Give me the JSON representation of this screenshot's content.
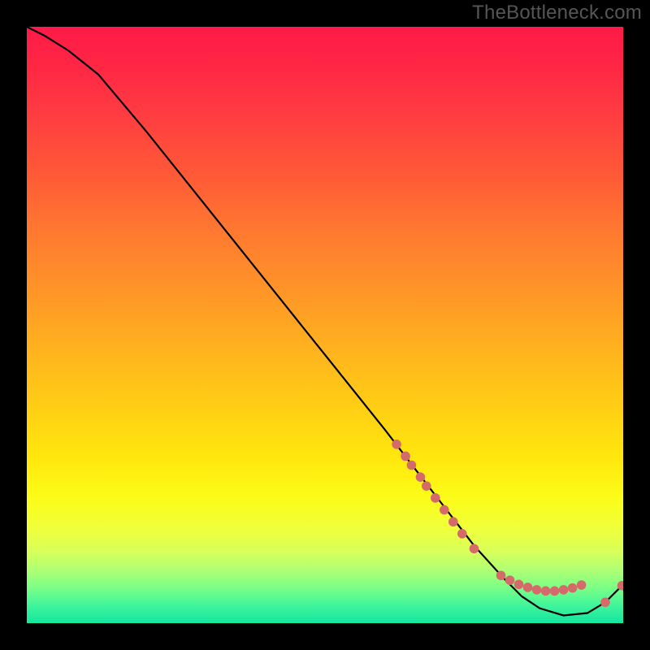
{
  "watermark": "TheBottleneck.com",
  "chart_data": {
    "type": "line",
    "title": "",
    "xlabel": "",
    "ylabel": "",
    "xlim": [
      0,
      100
    ],
    "ylim": [
      0,
      100
    ],
    "grid": false,
    "legend": false,
    "series": [
      {
        "name": "curve",
        "x": [
          0,
          3,
          7,
          12,
          20,
          30,
          40,
          50,
          60,
          65,
          70,
          75,
          80,
          83,
          86,
          90,
          94,
          97,
          100
        ],
        "y": [
          100,
          98.5,
          96,
          92,
          82.5,
          70,
          57.5,
          45,
          32.5,
          26,
          19.5,
          13,
          7.5,
          4.5,
          2.5,
          1.3,
          1.7,
          3.5,
          6.5
        ],
        "color": "#000000"
      }
    ],
    "markers": [
      {
        "name": "segment-dots",
        "color": "#d46a6a",
        "radius": 5.8,
        "points": [
          {
            "x": 62.0,
            "y": 30.0
          },
          {
            "x": 63.5,
            "y": 28.0
          },
          {
            "x": 64.5,
            "y": 26.5
          },
          {
            "x": 66.0,
            "y": 24.5
          },
          {
            "x": 67.0,
            "y": 23.0
          },
          {
            "x": 68.5,
            "y": 21.0
          },
          {
            "x": 70.0,
            "y": 19.0
          },
          {
            "x": 71.5,
            "y": 17.0
          },
          {
            "x": 73.0,
            "y": 15.0
          },
          {
            "x": 75.0,
            "y": 12.5
          }
        ]
      },
      {
        "name": "bottom-cluster",
        "color": "#d46a6a",
        "radius": 5.8,
        "points": [
          {
            "x": 79.5,
            "y": 8.0
          },
          {
            "x": 81.0,
            "y": 7.2
          },
          {
            "x": 82.5,
            "y": 6.5
          },
          {
            "x": 84.0,
            "y": 6.0
          },
          {
            "x": 85.5,
            "y": 5.6
          },
          {
            "x": 87.0,
            "y": 5.4
          },
          {
            "x": 88.5,
            "y": 5.4
          },
          {
            "x": 90.0,
            "y": 5.6
          },
          {
            "x": 91.5,
            "y": 5.9
          },
          {
            "x": 93.0,
            "y": 6.4
          }
        ]
      },
      {
        "name": "tail-dot",
        "color": "#d46a6a",
        "radius": 5.8,
        "points": [
          {
            "x": 97.0,
            "y": 3.5
          },
          {
            "x": 99.8,
            "y": 6.3
          }
        ]
      }
    ]
  }
}
